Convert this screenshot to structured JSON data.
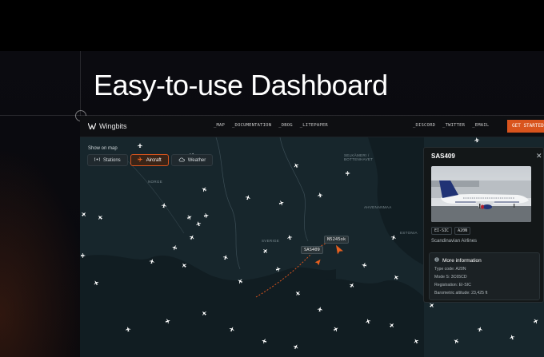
{
  "headline": "Easy-to-use Dashboard",
  "nav": {
    "brand": "Wingbits",
    "links": [
      "_MAP",
      "_DOCUMENTATION",
      "_DBOG",
      "_LITEPAPER"
    ],
    "right_links": [
      "_DISCORD",
      "_TWITTER",
      "_EMAIL"
    ],
    "cta": "GET STARTED"
  },
  "map_controls": {
    "title": "Show on map",
    "toggles": [
      {
        "label": "Stations",
        "icon": "radio-tower-icon",
        "active": false
      },
      {
        "label": "Aircraft",
        "icon": "airplane-icon",
        "active": true
      },
      {
        "label": "Weather",
        "icon": "cloud-icon",
        "active": false
      }
    ]
  },
  "map_labels": {
    "norge": "NORGE",
    "sverige": "SVERIGE",
    "selkaemeri": "SELKÄMERI /\nBOTTENHAVET",
    "ahvenanmaa": "AHVENANMAA",
    "estonia": "ESTONIA"
  },
  "flight_labels": {
    "selected": "SAS409",
    "other": "N5245ok"
  },
  "popup": {
    "flight": "SAS409",
    "close": "✕",
    "tags": [
      "EI-SIC",
      "A20N"
    ],
    "airline": "Scandinavian Airlines",
    "info_title": "More information",
    "rows": [
      "Type code: A20N",
      "Mode S: 3C65CD",
      "Registration: EI-SIC",
      "Barometric altitude: 23,425 ft"
    ]
  },
  "colors": {
    "accent": "#d9541d",
    "map_land": "#17262c",
    "map_water": "#111d22",
    "aircraft": "#ffffff"
  }
}
